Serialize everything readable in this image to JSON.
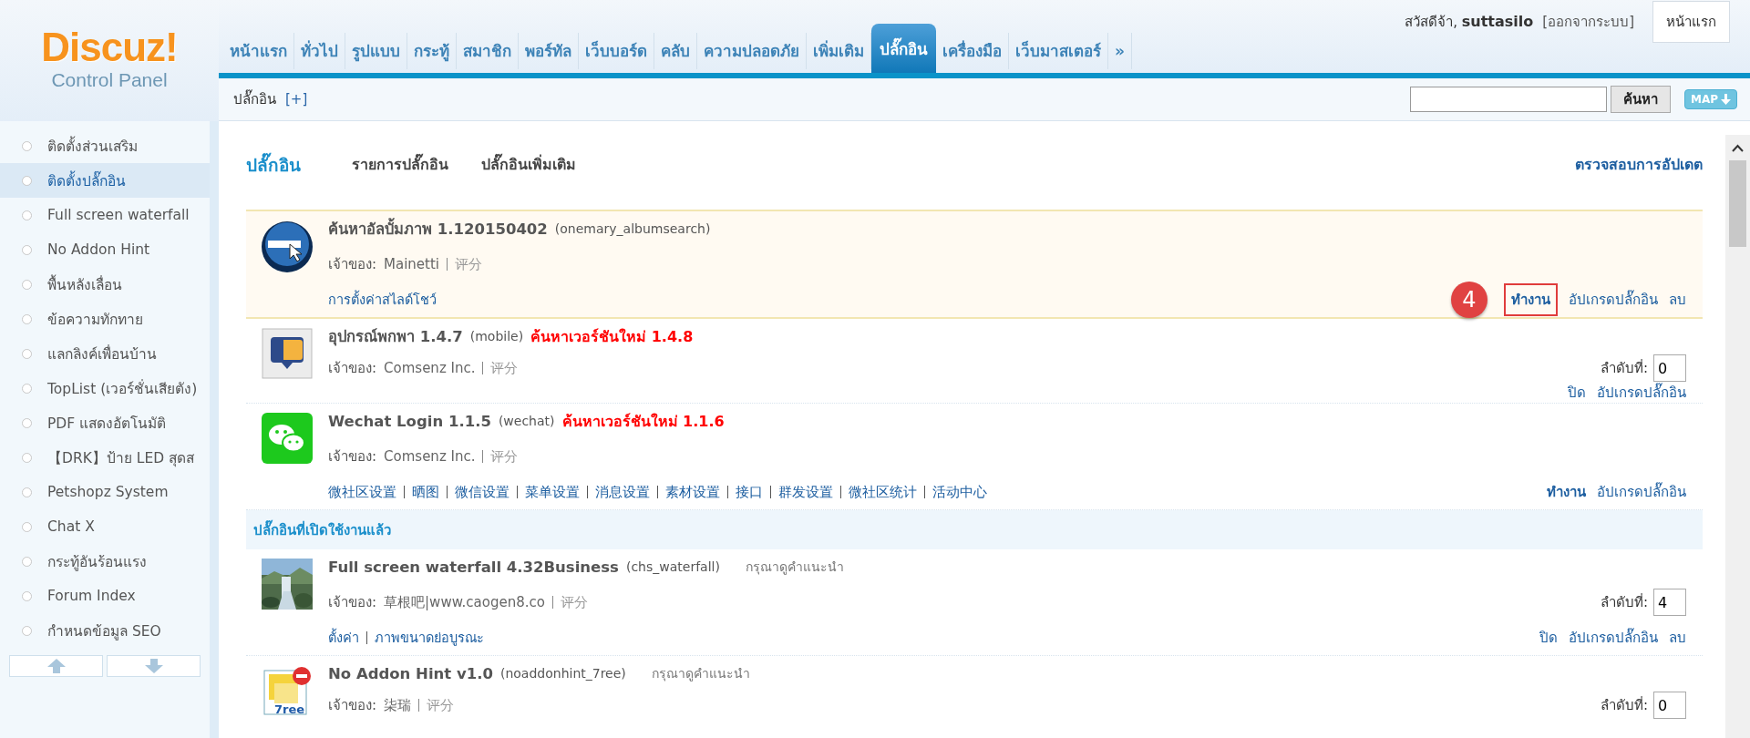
{
  "logo": {
    "title": "Discuz!",
    "subtitle": "Control Panel"
  },
  "nav": [
    {
      "label": "หน้าแรก",
      "selected": false
    },
    {
      "label": "ทั่วไป",
      "selected": false
    },
    {
      "label": "รูปแบบ",
      "selected": false
    },
    {
      "label": "กระทู้",
      "selected": false
    },
    {
      "label": "สมาชิก",
      "selected": false
    },
    {
      "label": "พอร์ทัล",
      "selected": false
    },
    {
      "label": "เว็บบอร์ด",
      "selected": false
    },
    {
      "label": "คลับ",
      "selected": false
    },
    {
      "label": "ความปลอดภัย",
      "selected": false
    },
    {
      "label": "เพิ่มเติม",
      "selected": false
    },
    {
      "label": "ปลั๊กอิน",
      "selected": true
    },
    {
      "label": "เครื่องมือ",
      "selected": false
    },
    {
      "label": "เว็บมาสเตอร์",
      "selected": false
    },
    {
      "label": "»",
      "selected": false
    }
  ],
  "user": {
    "greeting": "สวัสดีจ้า,",
    "username": "suttasilo",
    "logout": "[ออกจากระบบ]",
    "home_button": "หน้าแรก"
  },
  "breadcrumb": {
    "label": "ปลั๊กอิน",
    "add": "[+]"
  },
  "search": {
    "button": "ค้นหา",
    "map_button": "MAP"
  },
  "sidebar": {
    "items": [
      {
        "label": "ติดตั้งส่วนเสริม",
        "selected": false
      },
      {
        "label": "ติดตั้งปลั๊กอิน",
        "selected": true
      },
      {
        "label": "Full screen waterfall",
        "selected": false
      },
      {
        "label": "No Addon Hint",
        "selected": false
      },
      {
        "label": "พื้นหลังเลื่อน",
        "selected": false
      },
      {
        "label": "ข้อความทักทาย",
        "selected": false
      },
      {
        "label": "แลกลิงค์เพื่อนบ้าน",
        "selected": false
      },
      {
        "label": "TopList (เวอร์ชั่นเสียตัง)",
        "selected": false
      },
      {
        "label": "PDF แสดงอัตโนมัติ",
        "selected": false
      },
      {
        "label": "【DRK】ป้าย LED สุดส",
        "selected": false
      },
      {
        "label": "Petshopz System",
        "selected": false
      },
      {
        "label": "Chat X",
        "selected": false
      },
      {
        "label": "กระทู้อันร้อนแรง",
        "selected": false
      },
      {
        "label": "Forum Index",
        "selected": false
      },
      {
        "label": "กำหนดข้อมูล SEO",
        "selected": false
      }
    ]
  },
  "page_tabs": [
    {
      "label": "ปลั๊กอิน",
      "selected": true
    },
    {
      "label": "รายการปลั๊กอิน",
      "selected": false
    },
    {
      "label": "ปลั๊กอินเพิ่มเติม",
      "selected": false
    }
  ],
  "check_update": "ตรวจสอบการอัปเดต",
  "plugins": [
    {
      "kind": "plugin",
      "highlighted": true,
      "title": "ค้นหาอัลบั้มภาพ 1.120150402",
      "id": "(onemary_albumsearch)",
      "owner_label": "เจ้าของ:",
      "owner": "Mainetti",
      "rating": "评分",
      "settings": [
        "การตั้งค่าสไลด์โชว์"
      ],
      "callout": "4",
      "actions": [
        {
          "label": "ทำงาน",
          "emphasis": true,
          "marked": true
        },
        {
          "label": "อัปเกรดปลั๊กอิน",
          "emphasis": false,
          "marked": false
        },
        {
          "label": "ลบ",
          "emphasis": false,
          "marked": false
        }
      ]
    },
    {
      "kind": "plugin",
      "highlighted": false,
      "title": "อุปกรณ์พกพา 1.4.7",
      "id": "(mobile)",
      "update": "ค้นหาเวอร์ชันใหม่ 1.4.8",
      "owner_label": "เจ้าของ:",
      "owner": "Comsenz Inc.",
      "rating": "评分",
      "order_label": "ลำดับที่:",
      "order": "0",
      "actions": [
        {
          "label": "ปิด",
          "emphasis": false,
          "marked": false
        },
        {
          "label": "อัปเกรดปลั๊กอิน",
          "emphasis": false,
          "marked": false
        }
      ]
    },
    {
      "kind": "plugin",
      "highlighted": false,
      "title": "Wechat Login 1.1.5",
      "id": "(wechat)",
      "update": "ค้นหาเวอร์ชันใหม่ 1.1.6",
      "owner_label": "เจ้าของ:",
      "owner": "Comsenz Inc.",
      "rating": "评分",
      "settings": [
        "微社区设置",
        "晒图",
        "微信设置",
        "菜单设置",
        "消息设置",
        "素材设置",
        "接口",
        "群发设置",
        "微社区统计",
        "活动中心"
      ],
      "actions": [
        {
          "label": "ทำงาน",
          "emphasis": true,
          "marked": false
        },
        {
          "label": "อัปเกรดปลั๊กอิน",
          "emphasis": false,
          "marked": false
        }
      ]
    },
    {
      "kind": "section",
      "label": "ปลั๊กอินที่เปิดใช้งานแล้ว"
    },
    {
      "kind": "plugin",
      "highlighted": false,
      "title": "Full screen waterfall 4.32Business",
      "id": "(chs_waterfall)",
      "hint": "กรุณาดูคำแนะนำ",
      "owner_label": "เจ้าของ:",
      "owner": "草根吧|www.caogen8.co",
      "rating": "评分",
      "order_label": "ลำดับที่:",
      "order": "4",
      "settings": [
        "ตั้งค่า",
        "ภาพขนาดย่อบูรณะ"
      ],
      "actions": [
        {
          "label": "ปิด",
          "emphasis": false,
          "marked": false
        },
        {
          "label": "อัปเกรดปลั๊กอิน",
          "emphasis": false,
          "marked": false
        },
        {
          "label": "ลบ",
          "emphasis": false,
          "marked": false
        }
      ]
    },
    {
      "kind": "plugin",
      "icon_label": "7ree",
      "highlighted": false,
      "title": "No Addon Hint v1.0",
      "id": "(noaddonhint_7ree)",
      "hint": "กรุณาดูคำแนะนำ",
      "owner_label": "เจ้าของ:",
      "owner": "柒瑞",
      "rating": "评分",
      "order_label": "ลำดับที่:",
      "order": "0"
    }
  ]
}
